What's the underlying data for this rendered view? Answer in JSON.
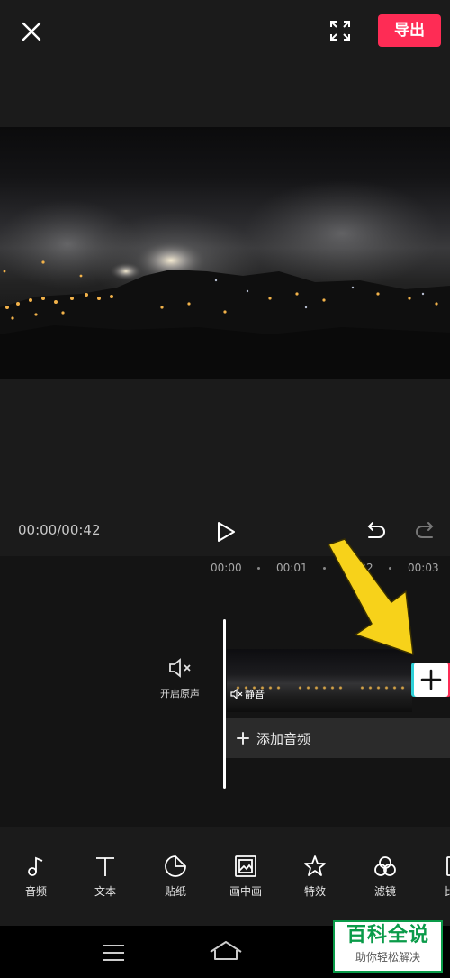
{
  "topbar": {
    "export_label": "导出"
  },
  "player": {
    "timecode": "00:00/00:42"
  },
  "timeline": {
    "ruler": [
      "00:00",
      "00:01",
      "00:02",
      "00:03"
    ],
    "mute_label": "开启原声",
    "clip_mute_tag": "静音",
    "add_audio_label": "添加音频"
  },
  "toolbar": {
    "items": [
      {
        "label": "音频",
        "icon": "music-note-icon"
      },
      {
        "label": "文本",
        "icon": "text-icon"
      },
      {
        "label": "贴纸",
        "icon": "sticker-icon"
      },
      {
        "label": "画中画",
        "icon": "picture-in-picture-icon"
      },
      {
        "label": "特效",
        "icon": "effects-star-icon"
      },
      {
        "label": "滤镜",
        "icon": "filter-icon"
      },
      {
        "label": "比",
        "icon": "ratio-icon"
      }
    ]
  },
  "watermark": {
    "title": "百科全说",
    "subtitle": "助你轻松解决"
  },
  "colors": {
    "accent": "#fe2c55",
    "cyan": "#2fd1d9",
    "arrow": "#f7d21a",
    "watermark_green": "#0a9b49"
  }
}
